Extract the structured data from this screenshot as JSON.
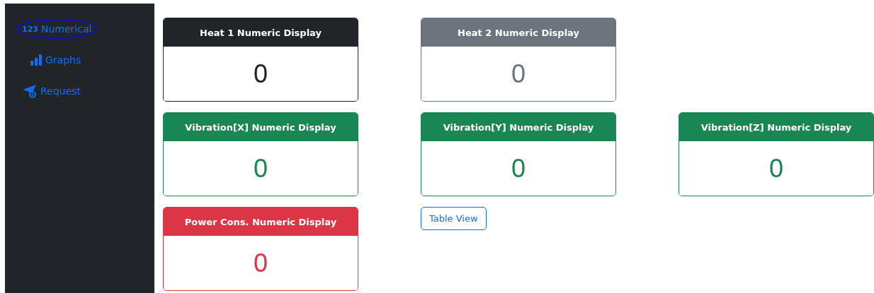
{
  "sidebar": {
    "items": [
      {
        "kind": "numeric",
        "label": "Numerical",
        "icon_text": "123",
        "selected": true
      },
      {
        "kind": "graphs",
        "label": "Graphs",
        "selected": false
      },
      {
        "kind": "request",
        "label": "Request",
        "selected": false
      }
    ]
  },
  "rows": [
    [
      {
        "kind": "card",
        "title": "Heat 1 Numeric Display",
        "value": "0",
        "color": "#212529"
      },
      {
        "kind": "card",
        "title": "Heat 2 Numeric Display",
        "value": "0",
        "color": "#6c757d"
      }
    ],
    [
      {
        "kind": "card",
        "title": "Vibration[X] Numeric Display",
        "value": "0",
        "color": "#198754"
      },
      {
        "kind": "card",
        "title": "Vibration[Y] Numeric Display",
        "value": "0",
        "color": "#198754"
      },
      {
        "kind": "card",
        "title": "Vibration[Z] Numeric Display",
        "value": "0",
        "color": "#198754"
      }
    ],
    [
      {
        "kind": "card",
        "title": "Power Cons. Numeric Display",
        "value": "0",
        "color": "#dc3545"
      },
      {
        "kind": "button",
        "label": "Table View"
      }
    ]
  ]
}
